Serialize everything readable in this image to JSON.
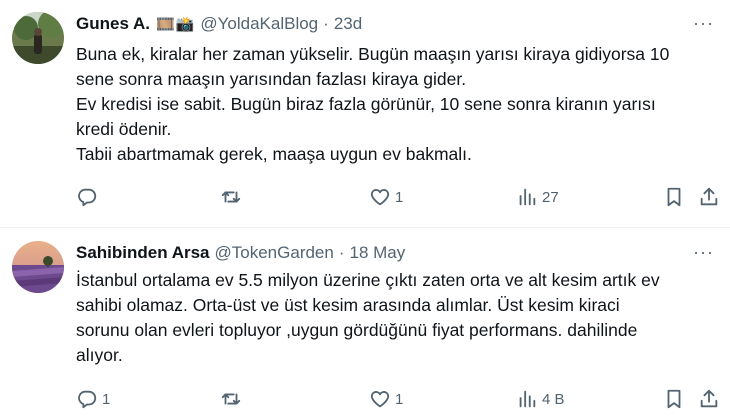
{
  "tweets": [
    {
      "name": "Gunes A.",
      "emoji": "🎞️📸",
      "handle": "@YoldaKalBlog",
      "separator": "·",
      "time": "23d",
      "more": "···",
      "lines": [
        "Buna ek, kiralar her zaman yükselir. Bugün maaşın yarısı kiraya gidiyorsa 10",
        "sene sonra maaşın yarısından fazlası kiraya gider.",
        "Ev kredisi ise sabit. Bugün biraz fazla görünür, 10 sene sonra kiranın yarısı",
        "kredi ödenir.",
        "Tabii abartmamak gerek, maaşa uygun ev bakmalı."
      ],
      "counts": {
        "reply": "",
        "retweet": "",
        "like": "1",
        "views": "27"
      },
      "icons": {
        "reply": "reply-icon",
        "retweet": "retweet-icon",
        "like": "heart-icon",
        "views": "views-icon",
        "bookmark": "bookmark-icon",
        "share": "share-icon"
      }
    },
    {
      "name": "Sahibinden Arsa",
      "handle": "@TokenGarden",
      "separator": "·",
      "time": "18 May",
      "more": "···",
      "lines": [
        "İstanbul ortalama ev 5.5 milyon üzerine çıktı zaten orta ve alt kesim artık ev",
        "sahibi olamaz. Orta-üst ve üst kesim arasında alımlar. Üst kesim kiraci",
        "sorunu olan evleri topluyor ,uygun gördüğünü fiyat performans. dahilinde",
        "alıyor."
      ],
      "counts": {
        "reply": "1",
        "retweet": "",
        "like": "1",
        "views": "4 B"
      },
      "icons": {
        "reply": "reply-icon",
        "retweet": "retweet-icon",
        "like": "heart-icon",
        "views": "views-icon",
        "bookmark": "bookmark-icon",
        "share": "share-icon"
      }
    }
  ],
  "colors": {
    "text": "#0f1419",
    "secondary": "#536471",
    "divider": "#eff3f4"
  }
}
